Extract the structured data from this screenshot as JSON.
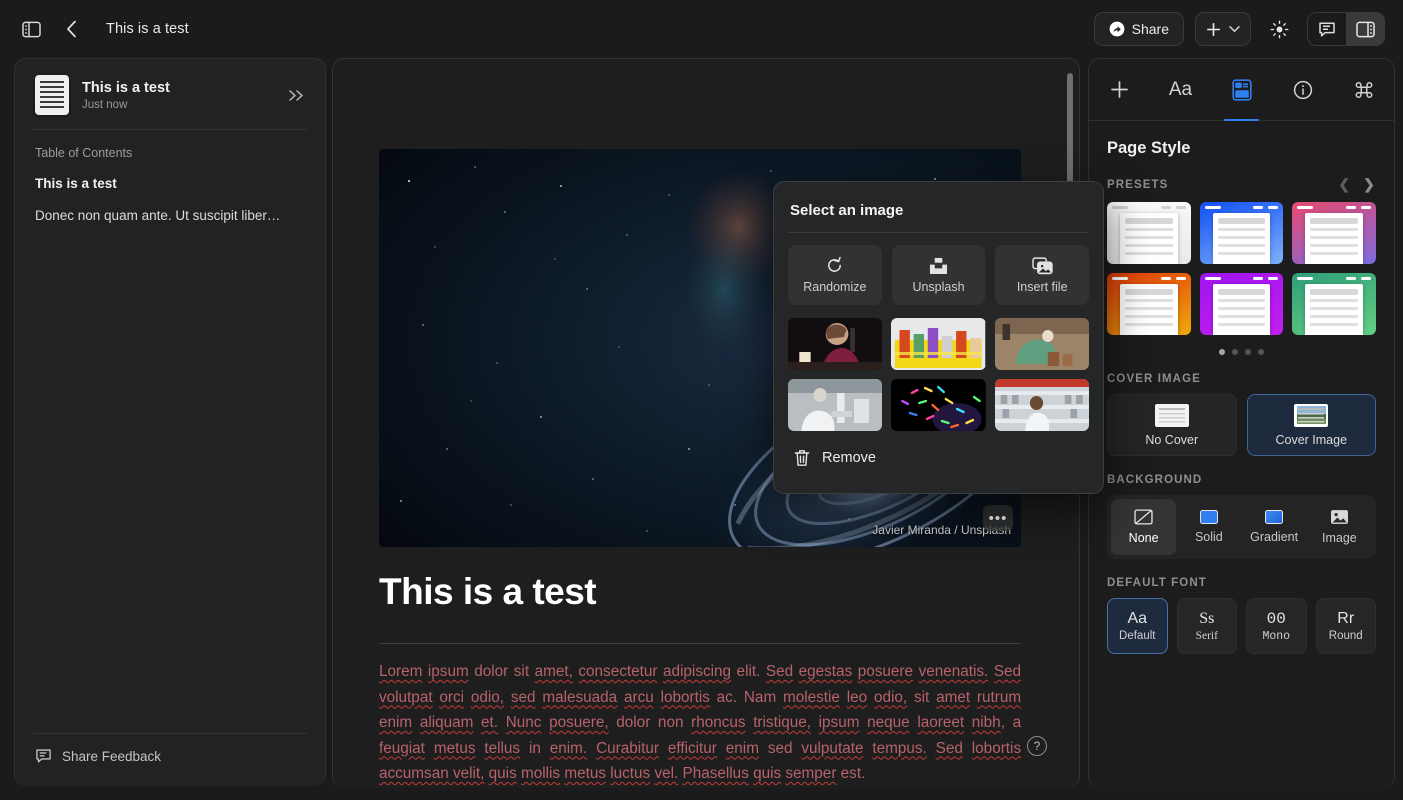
{
  "topbar": {
    "sidebar_toggle_icon": "panel-left-icon",
    "back_icon": "chevron-left-icon",
    "doc_title": "This is a test",
    "share_label": "Share",
    "share_icon": "share-arrow-icon",
    "plus_icon": "plus-icon",
    "plus_chevron_icon": "chevron-down-icon",
    "theme_icon": "sun-icon",
    "comments_icon": "comment-icon",
    "right_panel_icon": "panel-right-icon"
  },
  "sidebar": {
    "doc_icon": "document-icon",
    "doc_title": "This is a test",
    "doc_timestamp": "Just now",
    "collapse_icon": "double-chevron-right-icon",
    "toc_label": "Table of Contents",
    "toc_items": [
      {
        "text": "This is a test",
        "bold": true
      },
      {
        "text": "Donec non quam ante. Ut suscipit liber…",
        "bold": false
      }
    ],
    "feedback_icon": "comment-icon",
    "feedback_label": "Share Feedback"
  },
  "document": {
    "cover": {
      "alt": "spiral galaxy in deep space",
      "credit": "Javier Miranda / Unsplash",
      "more_label": "•••"
    },
    "heading": "This is a test",
    "body_segments": [
      {
        "t": "Lorem",
        "sp": true
      },
      {
        "t": " "
      },
      {
        "t": "ipsum",
        "sp": true
      },
      {
        "t": " dolor sit "
      },
      {
        "t": "amet,",
        "sp": true
      },
      {
        "t": " "
      },
      {
        "t": "consectetur",
        "sp": true
      },
      {
        "t": " "
      },
      {
        "t": "adipiscing",
        "sp": true
      },
      {
        "t": " elit. "
      },
      {
        "t": "Sed",
        "sp": true
      },
      {
        "t": " "
      },
      {
        "t": "egestas",
        "sp": true
      },
      {
        "t": " "
      },
      {
        "t": "posuere",
        "sp": true
      },
      {
        "t": " "
      },
      {
        "t": "venenatis.",
        "sp": true
      },
      {
        "t": " "
      },
      {
        "t": "Sed",
        "sp": true
      },
      {
        "t": " "
      },
      {
        "t": "volutpat",
        "sp": true
      },
      {
        "t": " "
      },
      {
        "t": "orci",
        "sp": true
      },
      {
        "t": " "
      },
      {
        "t": "odio,",
        "sp": true
      },
      {
        "t": " "
      },
      {
        "t": "sed",
        "sp": true
      },
      {
        "t": " "
      },
      {
        "t": "malesuada",
        "sp": true
      },
      {
        "t": " "
      },
      {
        "t": "arcu",
        "sp": true
      },
      {
        "t": " "
      },
      {
        "t": "lobortis",
        "sp": true
      },
      {
        "t": " ac. Nam "
      },
      {
        "t": "molestie",
        "sp": true
      },
      {
        "t": " "
      },
      {
        "t": "leo",
        "sp": true
      },
      {
        "t": " "
      },
      {
        "t": "odio,",
        "sp": true
      },
      {
        "t": " sit "
      },
      {
        "t": "amet",
        "sp": true
      },
      {
        "t": " "
      },
      {
        "t": "rutrum",
        "sp": true
      },
      {
        "t": " "
      },
      {
        "t": "enim",
        "sp": true
      },
      {
        "t": " "
      },
      {
        "t": "aliquam",
        "sp": true
      },
      {
        "t": " "
      },
      {
        "t": "et.",
        "sp": true
      },
      {
        "t": " "
      },
      {
        "t": "Nunc",
        "sp": true
      },
      {
        "t": " "
      },
      {
        "t": "posuere,",
        "sp": true
      },
      {
        "t": " dolor non "
      },
      {
        "t": "rhoncus",
        "sp": true
      },
      {
        "t": " "
      },
      {
        "t": "tristique,",
        "sp": true
      },
      {
        "t": " "
      },
      {
        "t": "ipsum",
        "sp": true
      },
      {
        "t": " "
      },
      {
        "t": "neque",
        "sp": true
      },
      {
        "t": " "
      },
      {
        "t": "laoreet",
        "sp": true
      },
      {
        "t": " "
      },
      {
        "t": "nibh",
        "sp": true
      },
      {
        "t": ", a "
      },
      {
        "t": "feugiat",
        "sp": true
      },
      {
        "t": " "
      },
      {
        "t": "metus",
        "sp": true
      },
      {
        "t": " "
      },
      {
        "t": "tellus",
        "sp": true
      },
      {
        "t": " in "
      },
      {
        "t": "enim.",
        "sp": true
      },
      {
        "t": " "
      },
      {
        "t": "Curabitur",
        "sp": true
      },
      {
        "t": " "
      },
      {
        "t": "efficitur",
        "sp": true
      },
      {
        "t": " "
      },
      {
        "t": "enim",
        "sp": true
      },
      {
        "t": " sed "
      },
      {
        "t": "vulputate",
        "sp": true
      },
      {
        "t": " "
      },
      {
        "t": "tempus.",
        "sp": true
      },
      {
        "t": " "
      },
      {
        "t": "Sed",
        "sp": true
      },
      {
        "t": " "
      },
      {
        "t": "lobortis",
        "sp": true
      },
      {
        "t": " "
      },
      {
        "t": "accumsan velit,",
        "sp": true
      },
      {
        "t": " "
      },
      {
        "t": "quis",
        "sp": true
      },
      {
        "t": " "
      },
      {
        "t": "mollis",
        "sp": true
      },
      {
        "t": " "
      },
      {
        "t": "metus",
        "sp": true
      },
      {
        "t": " "
      },
      {
        "t": "luctus",
        "sp": true
      },
      {
        "t": " "
      },
      {
        "t": "vel.",
        "sp": true
      },
      {
        "t": " "
      },
      {
        "t": "Phasellus",
        "sp": true
      },
      {
        "t": " "
      },
      {
        "t": "quis",
        "sp": true
      },
      {
        "t": " "
      },
      {
        "t": "semper",
        "sp": true
      },
      {
        "t": " est."
      }
    ],
    "help_label": "?"
  },
  "popup": {
    "title": "Select an image",
    "actions": [
      {
        "label": "Randomize",
        "icon": "refresh-icon"
      },
      {
        "label": "Unsplash",
        "icon": "unsplash-icon"
      },
      {
        "label": "Insert file",
        "icon": "images-icon"
      }
    ],
    "thumbnails": [
      {
        "alt": "woman in maroon top holding microphone at dark desk"
      },
      {
        "alt": "colorful test tubes in yellow rack"
      },
      {
        "alt": "archaeologist in green gown excavating"
      },
      {
        "alt": "scientist in white coat using microscope"
      },
      {
        "alt": "colorful bacteria on black background"
      },
      {
        "alt": "technician working in laboratory shelves"
      }
    ],
    "remove_label": "Remove",
    "remove_icon": "trash-icon"
  },
  "right_panel": {
    "tabs": [
      {
        "icon": "plus-icon",
        "name": "add",
        "active": false
      },
      {
        "icon": "text-format-icon",
        "name": "text",
        "active": false
      },
      {
        "icon": "page-style-icon",
        "name": "page-style",
        "active": true
      },
      {
        "icon": "info-icon",
        "name": "info",
        "active": false
      },
      {
        "icon": "command-icon",
        "name": "shortcuts",
        "active": false
      }
    ],
    "title": "Page Style",
    "presets_label": "PRESETS",
    "prev_icon": "chevron-left-icon",
    "next_icon": "chevron-right-icon",
    "presets": [
      {
        "name": "white",
        "bg": "linear-gradient(160deg,#fdfdfd,#e9e9e9)",
        "bar": "#d0d0d0"
      },
      {
        "name": "blue",
        "bg": "linear-gradient(160deg,#1150f5,#7fb0fb)",
        "bar": "#ffffff"
      },
      {
        "name": "pink",
        "bg": "linear-gradient(160deg,#e8496f,#7b6be0)",
        "bar": "#ffffff"
      },
      {
        "name": "orange",
        "bg": "linear-gradient(160deg,#e03a0a,#f0a90c)",
        "bar": "#ffffff"
      },
      {
        "name": "purple",
        "bg": "linear-gradient(160deg,#9f14f0,#c41ff0)",
        "bar": "#ffffff"
      },
      {
        "name": "green",
        "bg": "linear-gradient(160deg,#2f9e77,#63cf84)",
        "bar": "#ffffff"
      }
    ],
    "page_dots": [
      true,
      false,
      false,
      false
    ],
    "cover_label": "COVER IMAGE",
    "cover_options": [
      {
        "label": "No Cover",
        "selected": false
      },
      {
        "label": "Cover Image",
        "selected": true
      }
    ],
    "background_label": "BACKGROUND",
    "background_options": [
      {
        "label": "None",
        "icon": "none-icon",
        "selected": true
      },
      {
        "label": "Solid",
        "icon": "solid-swatch-icon",
        "selected": false
      },
      {
        "label": "Gradient",
        "icon": "gradient-swatch-icon",
        "selected": false
      },
      {
        "label": "Image",
        "icon": "image-icon",
        "selected": false
      }
    ],
    "font_label": "DEFAULT FONT",
    "fonts": [
      {
        "glyph": "Aa",
        "label": "Default",
        "selected": true
      },
      {
        "glyph": "Ss",
        "label": "Serif",
        "selected": false
      },
      {
        "glyph": "00",
        "label": "Mono",
        "selected": false
      },
      {
        "glyph": "Rr",
        "label": "Round",
        "selected": false
      }
    ]
  },
  "colors": {
    "accent": "#2f7ff0",
    "spellcheck": "#c33a3a",
    "body_text": "#b7636b"
  }
}
